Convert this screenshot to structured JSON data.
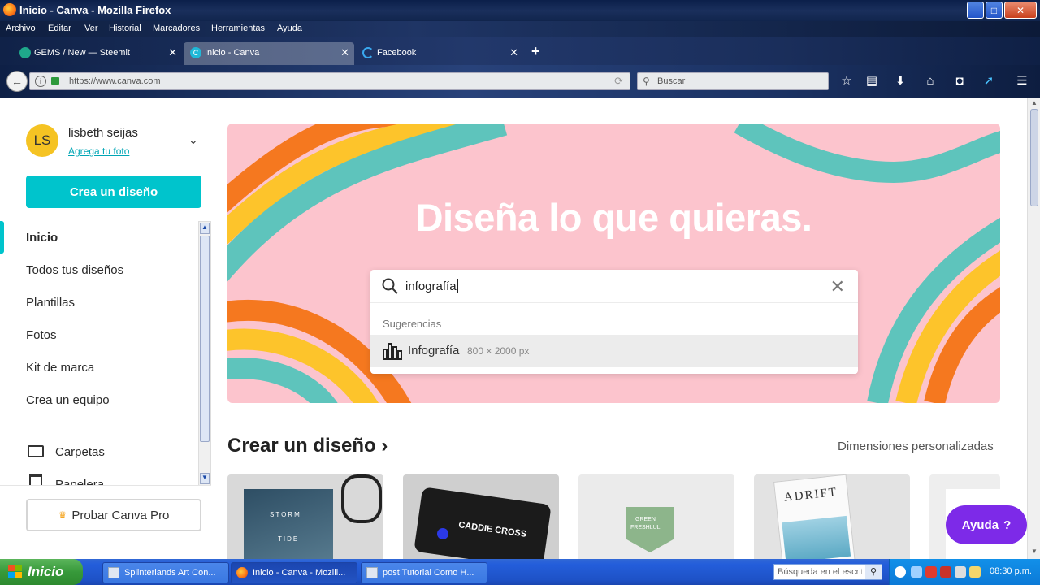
{
  "window": {
    "title": "Inicio - Canva - Mozilla Firefox",
    "controls": [
      "_",
      "□",
      "✕"
    ]
  },
  "menu": [
    "Archivo",
    "Editar",
    "Ver",
    "Historial",
    "Marcadores",
    "Herramientas",
    "Ayuda"
  ],
  "tabs": [
    {
      "label": "GEMS / New — Steemit",
      "close": "✕"
    },
    {
      "label": "Inicio - Canva",
      "close": "✕"
    },
    {
      "label": "Facebook",
      "close": "✕"
    }
  ],
  "new_tab": "+",
  "nav": {
    "url": "https://www.canva.com",
    "search_placeholder": "Buscar",
    "back": "←",
    "reload": "⟳",
    "info": "i",
    "icons": [
      "star-icon",
      "reading-list-icon",
      "download-icon",
      "home-icon",
      "pocket-icon",
      "extension-icon",
      "menu-icon"
    ]
  },
  "sidebar": {
    "avatar_initials": "LS",
    "username": "lisbeth seijas",
    "add_photo": "Agrega tu foto",
    "create_button": "Crea un diseño",
    "items": [
      {
        "label": "Inicio"
      },
      {
        "label": "Todos tus diseños"
      },
      {
        "label": "Plantillas"
      },
      {
        "label": "Fotos"
      },
      {
        "label": "Kit de marca"
      },
      {
        "label": "Crea un equipo"
      },
      {
        "label": "Carpetas"
      },
      {
        "label": "Papelera"
      }
    ],
    "pro_button": "Probar Canva Pro"
  },
  "hero": {
    "title": "Diseña lo que quieras.",
    "search_value": "infografía",
    "suggestions_heading": "Sugerencias",
    "suggestion": {
      "name": "Infografía",
      "dims": "800 × 2000 px"
    },
    "colors": {
      "background": "#fcc4cd",
      "orange": "#f5781f",
      "yellow": "#fdc42b",
      "teal": "#5ec4bc"
    }
  },
  "create_section": {
    "title": "Crear un diseño",
    "chevron": "›",
    "custom_dims": "Dimensiones personalizadas",
    "cards": [
      {
        "text1": "STORM",
        "text2": "TIDE"
      },
      {
        "text1": "CADDIE CROSS"
      },
      {
        "text1": "GREEN",
        "text2": "FRESHLUL"
      },
      {
        "text1": "ADRIFT"
      },
      {
        "text1": ""
      }
    ]
  },
  "help_button": "Ayuda",
  "help_symbol": "?",
  "taskbar": {
    "start": "Inicio",
    "tasks": [
      {
        "label": "Splinterlands Art Con..."
      },
      {
        "label": "Inicio - Canva - Mozill..."
      },
      {
        "label": "post Tutorial Como H..."
      }
    ],
    "search_placeholder": "Búsqueda en el escritorio",
    "clock": "08:30 p.m."
  }
}
